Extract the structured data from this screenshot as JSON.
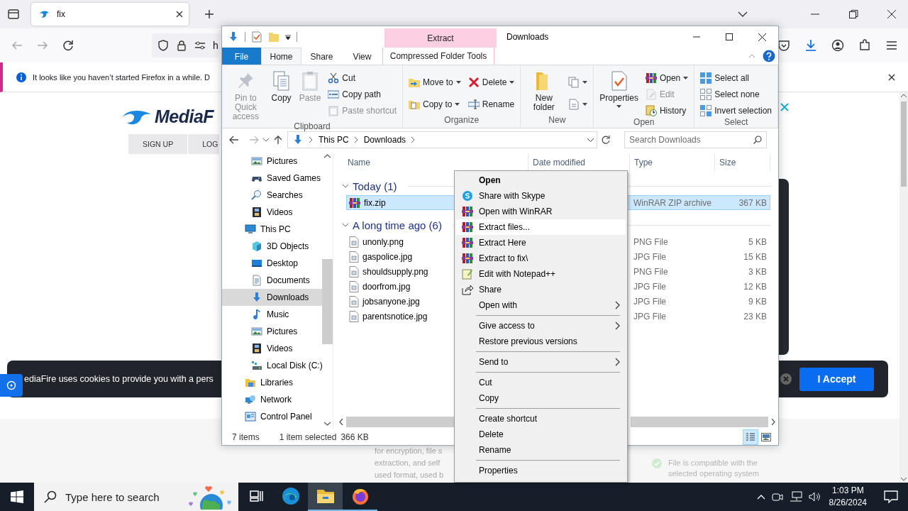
{
  "browser": {
    "tab": {
      "title": "fix"
    },
    "address": {
      "text": "h"
    },
    "notification": {
      "text": "It looks like you haven’t started Firefox in a while. D"
    },
    "page": {
      "logo": "MediaF",
      "nav_buttons": [
        "SIGN UP",
        "LOG"
      ],
      "cookie_banner": {
        "text": "ediaFire uses cookies to provide you with a pers",
        "button": "I Accept"
      },
      "description_lines": [
        "for encryption, file s",
        "extraction, and self",
        "used format, used b"
      ],
      "compatibility": "File is compatible with the selected operating system"
    }
  },
  "explorer": {
    "title": "Downloads",
    "context_tab": {
      "header": "Extract",
      "label": "Compressed Folder Tools"
    },
    "tabs": [
      {
        "label": "File",
        "kind": "file",
        "selected": false
      },
      {
        "label": "Home",
        "kind": "tab",
        "selected": true
      },
      {
        "label": "Share",
        "kind": "tab",
        "selected": false
      },
      {
        "label": "View",
        "kind": "tab",
        "selected": false
      }
    ],
    "ribbon": [
      {
        "label": "Clipboard",
        "columns": [
          [
            {
              "label": "Pin to Quick access",
              "kind": "large",
              "disabled": true,
              "dropdown": false
            }
          ],
          [
            {
              "label": "Copy",
              "kind": "large",
              "disabled": false,
              "dropdown": false
            }
          ],
          [
            {
              "label": "Paste",
              "kind": "large",
              "disabled": true,
              "dropdown": false
            }
          ],
          [
            {
              "label": "Cut",
              "kind": "small",
              "disabled": false,
              "dropdown": false
            },
            {
              "label": "Copy path",
              "kind": "small",
              "disabled": false,
              "dropdown": false
            },
            {
              "label": "Paste shortcut",
              "kind": "small",
              "disabled": true,
              "dropdown": false
            }
          ]
        ]
      },
      {
        "label": "Organize",
        "columns": [
          [
            {
              "label": "Move to",
              "kind": "medium",
              "disabled": false,
              "dropdown": true
            },
            {
              "label": "Copy to",
              "kind": "medium",
              "disabled": false,
              "dropdown": true
            }
          ],
          [
            {
              "label": "Delete",
              "kind": "medium",
              "disabled": false,
              "dropdown": true
            },
            {
              "label": "Rename",
              "kind": "medium",
              "disabled": false,
              "dropdown": false
            }
          ]
        ]
      },
      {
        "label": "New",
        "columns": [
          [
            {
              "label": "New folder",
              "kind": "large",
              "disabled": false,
              "dropdown": false
            }
          ],
          [
            {
              "kind": "small",
              "disabled": false,
              "dropdown": true
            },
            {
              "kind": "small",
              "disabled": false,
              "dropdown": true
            }
          ]
        ]
      },
      {
        "label": "Open",
        "columns": [
          [
            {
              "label": "Properties",
              "kind": "large",
              "disabled": false,
              "dropdown": true
            }
          ],
          [
            {
              "label": "Open",
              "kind": "small",
              "disabled": false,
              "dropdown": true
            },
            {
              "label": "Edit",
              "kind": "small",
              "disabled": true,
              "dropdown": false
            },
            {
              "label": "History",
              "kind": "small",
              "disabled": false,
              "dropdown": false
            }
          ]
        ]
      },
      {
        "label": "Select",
        "columns": [
          [
            {
              "label": "Select all",
              "kind": "small",
              "disabled": false,
              "dropdown": false
            },
            {
              "label": "Select none",
              "kind": "small",
              "disabled": false,
              "dropdown": false
            },
            {
              "label": "Invert selection",
              "kind": "small",
              "disabled": false,
              "dropdown": false
            }
          ]
        ]
      }
    ],
    "address": {
      "path": [
        "This PC",
        "Downloads"
      ]
    },
    "search": {
      "placeholder": "Search Downloads"
    },
    "nav": [
      {
        "children": [
          {
            "label": "Pictures",
            "kind": "pictures",
            "selected": false
          },
          {
            "label": "Saved Games",
            "kind": "games",
            "selected": false
          },
          {
            "label": "Searches",
            "kind": "search",
            "selected": false
          },
          {
            "label": "Videos",
            "kind": "videos",
            "selected": false
          }
        ]
      },
      {
        "label": "This PC",
        "kind": "pc",
        "selected": false,
        "children": [
          {
            "label": "3D Objects",
            "kind": "objects",
            "selected": false
          },
          {
            "label": "Desktop",
            "kind": "desktop",
            "selected": false
          },
          {
            "label": "Documents",
            "kind": "documents",
            "selected": false
          },
          {
            "label": "Downloads",
            "kind": "downloads",
            "selected": true
          },
          {
            "label": "Music",
            "kind": "music",
            "selected": false
          },
          {
            "label": "Pictures",
            "kind": "pictures",
            "selected": false
          },
          {
            "label": "Videos",
            "kind": "videos",
            "selected": false
          },
          {
            "label": "Local Disk (C:)",
            "kind": "disk",
            "selected": false
          }
        ]
      },
      {
        "label": "Libraries",
        "kind": "libraries",
        "selected": false
      },
      {
        "label": "Network",
        "kind": "network",
        "selected": false
      },
      {
        "label": "Control Panel",
        "kind": "control",
        "selected": false
      }
    ],
    "columns": [
      "Name",
      "Date modified",
      "Type",
      "Size"
    ],
    "groups": [
      {
        "title": "Today (1)",
        "expanded": true,
        "files": [
          {
            "name": "fix.zip",
            "type": "WinRAR ZIP archive",
            "size": "367 KB",
            "kind": "archive",
            "selected": true
          }
        ]
      },
      {
        "title": "A long time ago (6)",
        "expanded": true,
        "files": [
          {
            "name": "unonly.png",
            "type": "PNG File",
            "size": "5 KB",
            "kind": "image",
            "selected": false
          },
          {
            "name": "gaspolice.jpg",
            "type": "JPG File",
            "size": "15 KB",
            "kind": "image",
            "selected": false
          },
          {
            "name": "shouldsupply.png",
            "type": "PNG File",
            "size": "3 KB",
            "kind": "image",
            "selected": false
          },
          {
            "name": "doorfrom.jpg",
            "type": "JPG File",
            "size": "12 KB",
            "kind": "image",
            "selected": false
          },
          {
            "name": "jobsanyone.jpg",
            "type": "JPG File",
            "size": "9 KB",
            "kind": "image",
            "selected": false
          },
          {
            "name": "parentsnotice.jpg",
            "type": "JPG File",
            "size": "23 KB",
            "kind": "image",
            "selected": false
          }
        ]
      }
    ],
    "status": {
      "count": "7 items",
      "selection": "1 item selected",
      "size": "366 KB"
    },
    "views": [
      {
        "kind": "details",
        "selected": true
      },
      {
        "kind": "large-icons",
        "selected": false
      }
    ]
  },
  "context_menu": [
    {
      "label": "Open",
      "kind": "plain",
      "default": true,
      "selected": false,
      "submenu": false
    },
    {
      "label": "Share with Skype",
      "kind": "skype",
      "default": false,
      "selected": false,
      "submenu": false
    },
    {
      "label": "Open with WinRAR",
      "kind": "winrar",
      "default": false,
      "selected": false,
      "submenu": false
    },
    {
      "label": "Extract files...",
      "kind": "winrar",
      "default": false,
      "selected": true,
      "submenu": false
    },
    {
      "label": "Extract Here",
      "kind": "winrar",
      "default": false,
      "selected": false,
      "submenu": false
    },
    {
      "label": "Extract to fix\\",
      "kind": "winrar",
      "default": false,
      "selected": false,
      "submenu": false
    },
    {
      "label": "Edit with Notepad++",
      "kind": "notepad",
      "default": false,
      "selected": false,
      "submenu": false
    },
    {
      "label": "Share",
      "kind": "share",
      "default": false,
      "selected": false,
      "submenu": false
    },
    {
      "label": "Open with",
      "kind": "plain",
      "default": false,
      "selected": false,
      "submenu": true
    },
    {
      "kind": "separator"
    },
    {
      "label": "Give access to",
      "kind": "plain",
      "default": false,
      "selected": false,
      "submenu": true
    },
    {
      "label": "Restore previous versions",
      "kind": "plain",
      "default": false,
      "selected": false,
      "submenu": false
    },
    {
      "kind": "separator"
    },
    {
      "label": "Send to",
      "kind": "plain",
      "default": false,
      "selected": false,
      "submenu": true
    },
    {
      "kind": "separator"
    },
    {
      "label": "Cut",
      "kind": "plain",
      "default": false,
      "selected": false,
      "submenu": false
    },
    {
      "label": "Copy",
      "kind": "plain",
      "default": false,
      "selected": false,
      "submenu": false
    },
    {
      "kind": "separator"
    },
    {
      "label": "Create shortcut",
      "kind": "plain",
      "default": false,
      "selected": false,
      "submenu": false
    },
    {
      "label": "Delete",
      "kind": "plain",
      "default": false,
      "selected": false,
      "submenu": false
    },
    {
      "label": "Rename",
      "kind": "plain",
      "default": false,
      "selected": false,
      "submenu": false
    },
    {
      "kind": "separator"
    },
    {
      "label": "Properties",
      "kind": "plain",
      "default": false,
      "selected": false,
      "submenu": false
    }
  ],
  "taskbar": {
    "search_placeholder": "Type here to search",
    "apps": [
      {
        "kind": "task-view",
        "selected": false,
        "running": false
      },
      {
        "kind": "edge",
        "selected": false,
        "running": false
      },
      {
        "kind": "explorer",
        "selected": true,
        "running": true
      },
      {
        "kind": "firefox",
        "selected": false,
        "running": true
      }
    ],
    "time": "1:03 PM",
    "date": "8/26/2024"
  }
}
